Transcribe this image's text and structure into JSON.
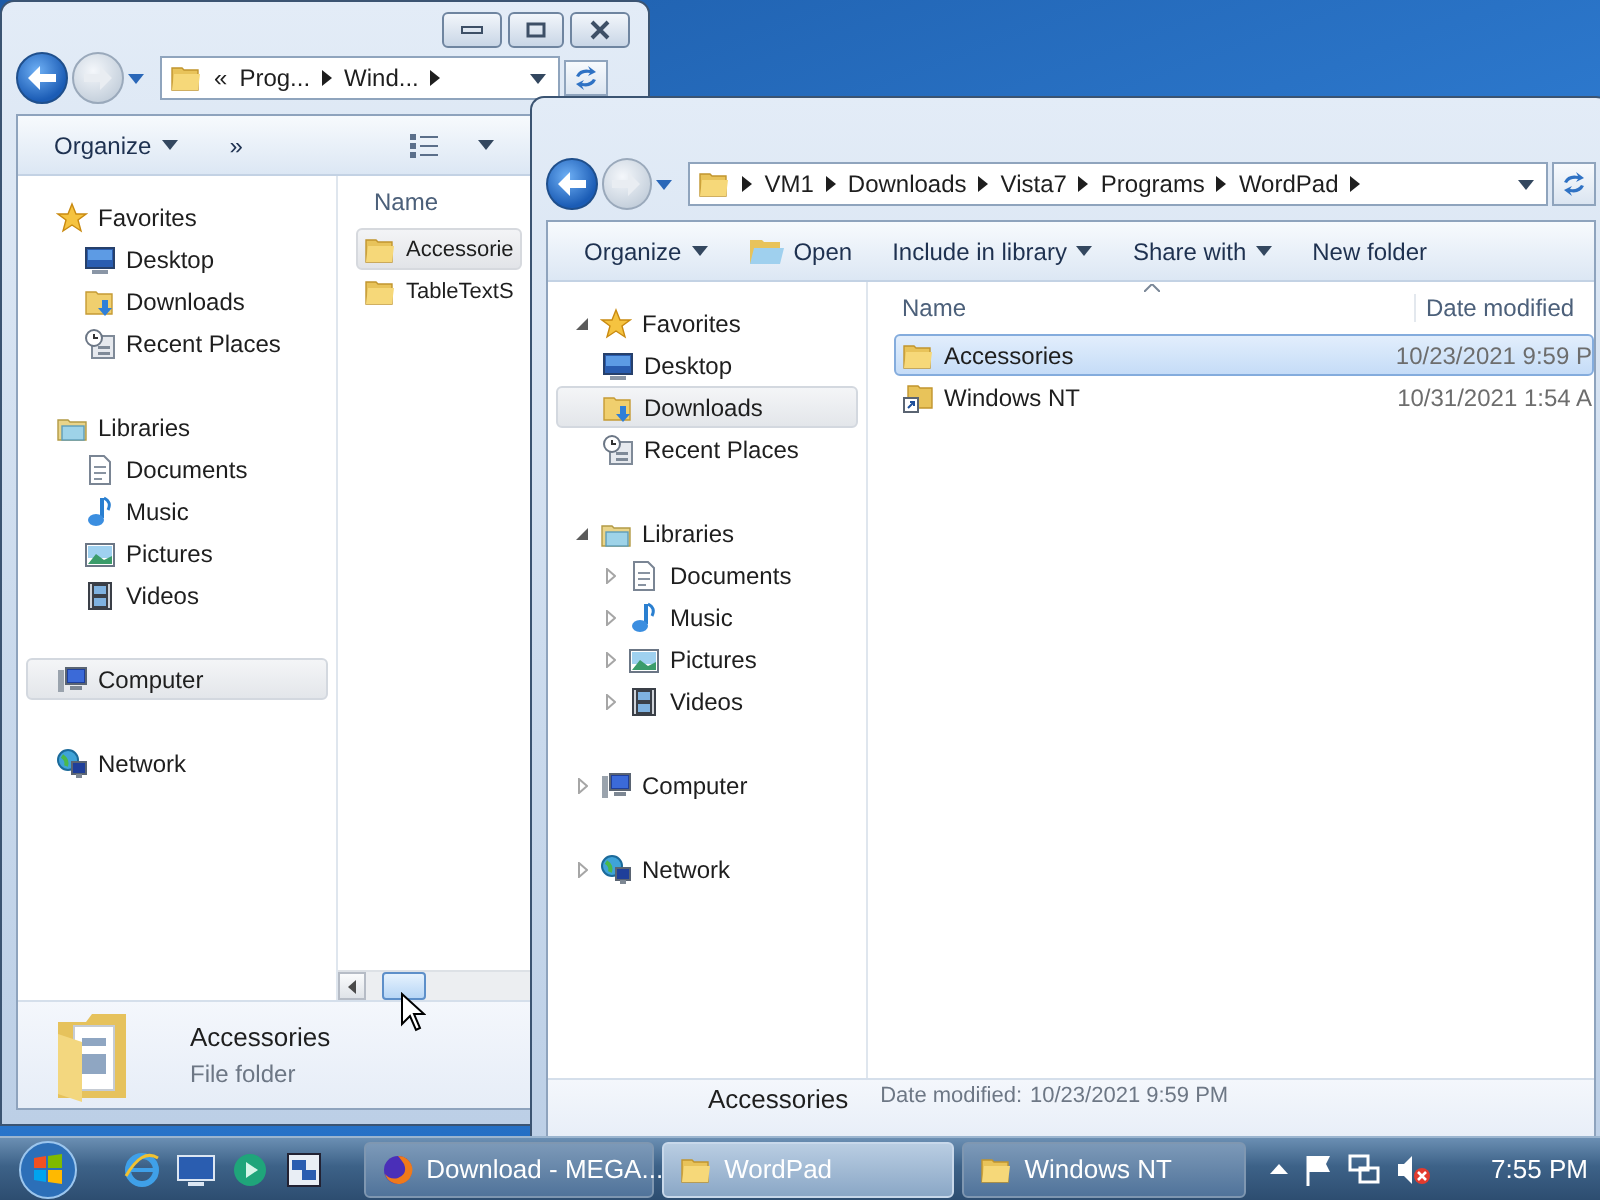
{
  "back_window": {
    "address": {
      "overflow": "«",
      "crumbs": [
        "Prog...",
        "Wind..."
      ]
    },
    "toolbar": [
      {
        "label": "Organize",
        "kind": "menu"
      },
      {
        "label": "»",
        "kind": "overflow"
      },
      {
        "kind": "view"
      }
    ],
    "nav": [
      {
        "label": "Favorites",
        "kind": "favorites",
        "selected": false,
        "children": [
          {
            "label": "Desktop",
            "kind": "desktop",
            "selected": false
          },
          {
            "label": "Downloads",
            "kind": "downloads",
            "selected": false
          },
          {
            "label": "Recent Places",
            "kind": "recent",
            "selected": false
          }
        ]
      },
      {
        "label": "Libraries",
        "kind": "libraries",
        "selected": false,
        "children": [
          {
            "label": "Documents",
            "kind": "documents",
            "selected": false
          },
          {
            "label": "Music",
            "kind": "music",
            "selected": false
          },
          {
            "label": "Pictures",
            "kind": "pictures",
            "selected": false
          },
          {
            "label": "Videos",
            "kind": "videos",
            "selected": false
          }
        ]
      },
      {
        "label": "Computer",
        "kind": "computer",
        "selected": true
      },
      {
        "label": "Network",
        "kind": "network",
        "selected": false
      }
    ],
    "columns": [
      "Name"
    ],
    "files": [
      {
        "name": "Accessorie",
        "kind": "folder",
        "selected": true
      },
      {
        "name": "TableTextS",
        "kind": "folder",
        "selected": false
      }
    ],
    "details": {
      "name": "Accessories",
      "type": "File folder"
    }
  },
  "front_window": {
    "address": {
      "crumbs": [
        "VM1",
        "Downloads",
        "Vista7",
        "Programs",
        "WordPad"
      ]
    },
    "toolbar": [
      {
        "label": "Organize",
        "kind": "menu"
      },
      {
        "label": "Open",
        "kind": "open"
      },
      {
        "label": "Include in library",
        "kind": "menu"
      },
      {
        "label": "Share with",
        "kind": "menu"
      },
      {
        "label": "New folder",
        "kind": "button"
      }
    ],
    "nav": [
      {
        "label": "Favorites",
        "kind": "favorites",
        "expanded": true,
        "selected": false,
        "children": [
          {
            "label": "Desktop",
            "kind": "desktop",
            "selected": false
          },
          {
            "label": "Downloads",
            "kind": "downloads",
            "selected": true
          },
          {
            "label": "Recent Places",
            "kind": "recent",
            "selected": false
          }
        ]
      },
      {
        "label": "Libraries",
        "kind": "libraries",
        "expanded": true,
        "selected": false,
        "children": [
          {
            "label": "Documents",
            "kind": "documents",
            "expanded": false,
            "selected": false
          },
          {
            "label": "Music",
            "kind": "music",
            "expanded": false,
            "selected": false
          },
          {
            "label": "Pictures",
            "kind": "pictures",
            "expanded": false,
            "selected": false
          },
          {
            "label": "Videos",
            "kind": "videos",
            "expanded": false,
            "selected": false
          }
        ]
      },
      {
        "label": "Computer",
        "kind": "computer",
        "expanded": false,
        "selected": false
      },
      {
        "label": "Network",
        "kind": "network",
        "expanded": false,
        "selected": false
      }
    ],
    "columns": [
      "Name",
      "Date modified"
    ],
    "files": [
      {
        "name": "Accessories",
        "kind": "folder",
        "date": "10/23/2021 9:59 P",
        "selected": true
      },
      {
        "name": "Windows NT",
        "kind": "shortcut",
        "date": "10/31/2021 1:54 A",
        "selected": false
      }
    ],
    "details": {
      "name": "Accessories",
      "label": "Date modified:",
      "value": "10/23/2021 9:59 PM"
    }
  },
  "taskbar": {
    "buttons": [
      {
        "label": "Download - MEGA...",
        "kind": "browser",
        "selected": false
      },
      {
        "label": "WordPad",
        "kind": "folder",
        "selected": true
      },
      {
        "label": "Windows NT",
        "kind": "folder",
        "selected": false
      }
    ],
    "clock": "7:55 PM"
  }
}
